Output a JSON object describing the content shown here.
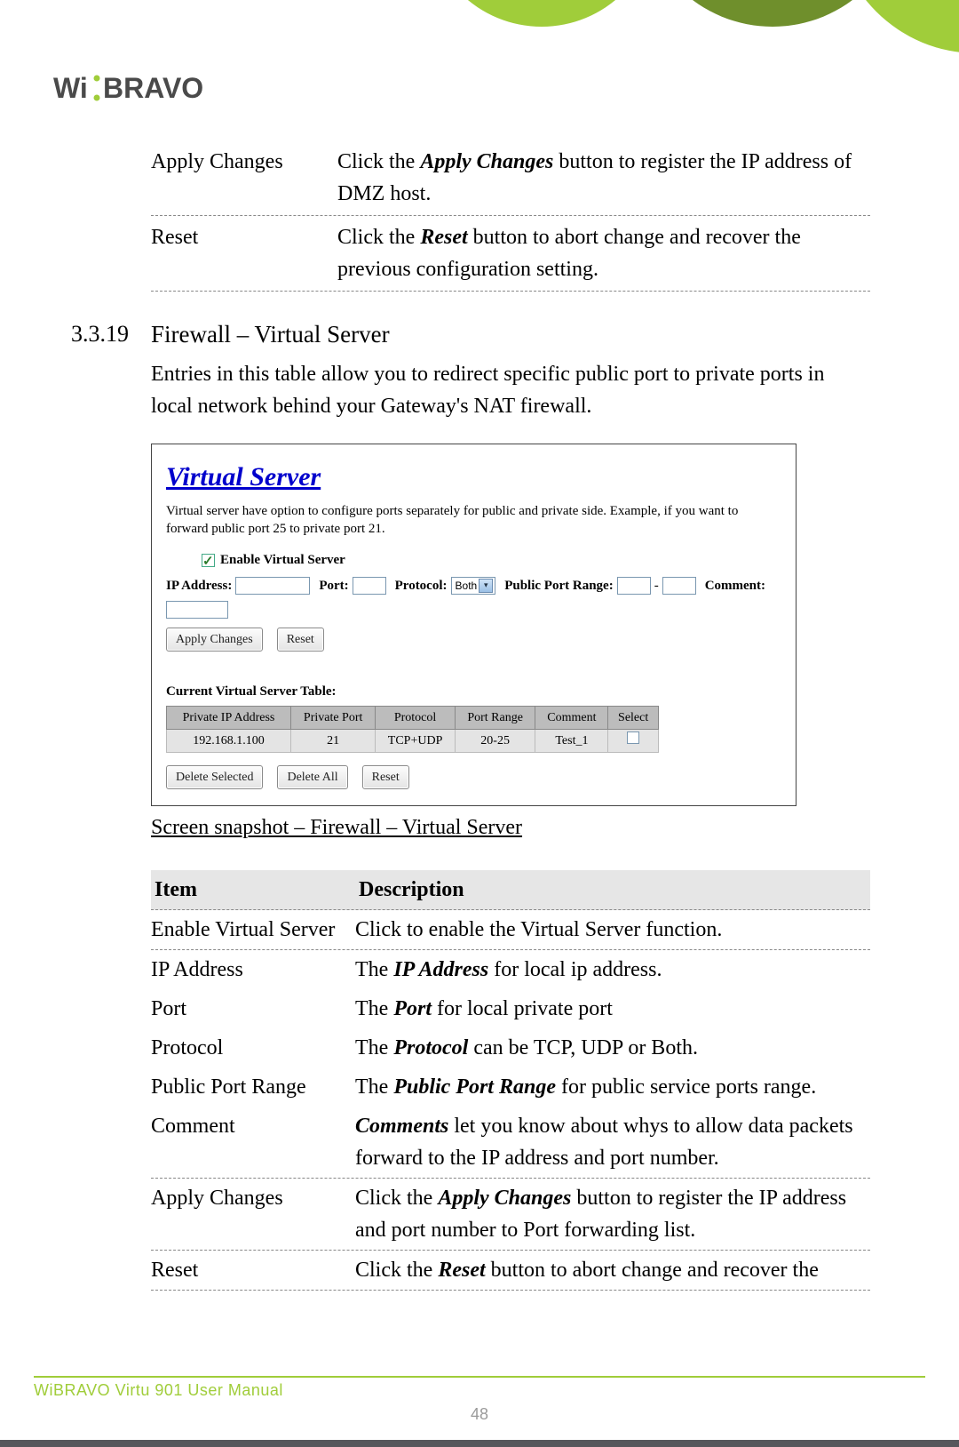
{
  "brand": {
    "accent": "#a0cd3a",
    "deco_dark": "#6f8f2c"
  },
  "logo_text": {
    "a": "Wi",
    "b": "BRAVO"
  },
  "top_rows": [
    {
      "term": "Apply Changes",
      "desc_pre": "Click the ",
      "desc_b": "Apply Changes",
      "desc_post": " button to register the IP address of DMZ host."
    },
    {
      "term": "Reset",
      "desc_pre": "Click the ",
      "desc_b": "Reset",
      "desc_post": " button to abort change and recover the previous configuration setting."
    }
  ],
  "section": {
    "number": "3.3.19",
    "title": "Firewall – Virtual Server",
    "intro": "Entries in this table allow you to redirect specific public port to private ports in local network behind your Gateway's NAT firewall."
  },
  "shot": {
    "title": "Virtual Server",
    "desc": "Virtual server have option to configure ports separately for public and private side. Example, if you want to forward public port 25 to private port 21.",
    "enable_label": "Enable Virtual Server",
    "labels": {
      "ip": "IP Address:",
      "port": "Port:",
      "proto": "Protocol:",
      "proto_val": "Both",
      "ppr": "Public Port Range:",
      "dash": "-",
      "comment": "Comment:"
    },
    "buttons": {
      "apply": "Apply Changes",
      "reset": "Reset",
      "del_sel": "Delete Selected",
      "del_all": "Delete All",
      "reset2": "Reset"
    },
    "tablehead": "Current Virtual Server Table:",
    "cols": [
      "Private IP Address",
      "Private Port",
      "Protocol",
      "Port Range",
      "Comment",
      "Select"
    ],
    "row": {
      "ip": "192.168.1.100",
      "port": "21",
      "proto": "TCP+UDP",
      "range": "20-25",
      "comment": "Test_1"
    }
  },
  "caption": "Screen snapshot – Firewall – Virtual Server",
  "idtable": {
    "h1": "Item",
    "h2": "Description",
    "rows": [
      {
        "item": "Enable Virtual Server",
        "pre": "Click to enable the Virtual Server function.",
        "b": "",
        "post": "",
        "border": true
      },
      {
        "item": "IP Address",
        "pre": "The ",
        "b": "IP Address",
        "post": " for local ip address.",
        "border": false
      },
      {
        "item": "Port",
        "pre": "The ",
        "b": "Port",
        "post": " for local private port",
        "border": false
      },
      {
        "item": "Protocol",
        "pre": "The ",
        "b": "Protocol",
        "post": " can be TCP, UDP or Both.",
        "border": false
      },
      {
        "item": "Public Port Range",
        "pre": "The ",
        "b": "Public Port Range",
        "post": " for public service ports range.",
        "border": false
      },
      {
        "item": "Comment",
        "pre": "",
        "b": "Comments",
        "post": " let you know about whys to allow data packets forward to the IP address and port number.",
        "border": true
      },
      {
        "item": "Apply Changes",
        "pre": "Click the ",
        "b": "Apply Changes",
        "post": " button to register the IP address and port number to Port forwarding list.",
        "border": true
      },
      {
        "item": "Reset",
        "pre": "Click the ",
        "b": "Reset",
        "post": " button to abort change and recover the",
        "border": true
      }
    ]
  },
  "footer": {
    "text": "WiBRAVO Virtu 901 User Manual",
    "page": "48"
  }
}
